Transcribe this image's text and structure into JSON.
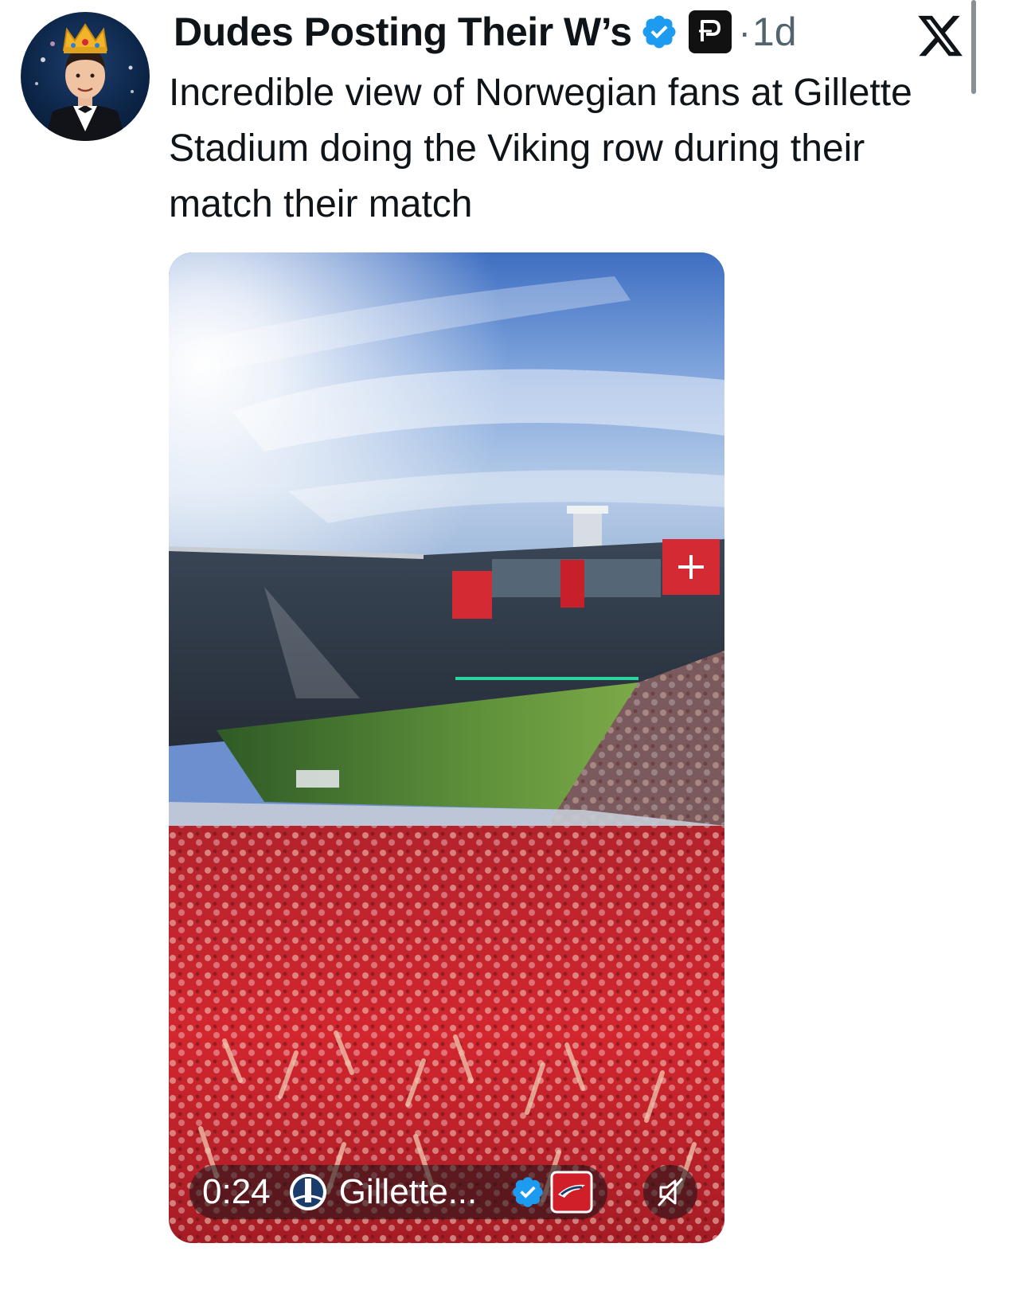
{
  "tweet": {
    "author": {
      "display_name": "Dudes Posting Their W’s",
      "verified": true,
      "affiliate_badge": "p-badge-icon",
      "avatar": "crowned-man-avatar"
    },
    "separator": "·",
    "timestamp": "1d",
    "text": "Incredible view of Norwegian fans at Gillette Stadium doing the Viking row during their match their match"
  },
  "media": {
    "type": "video",
    "elapsed": "0:24",
    "attribution": {
      "name": "Gillette...",
      "verified": true,
      "logo": "gillette-stadium-logo-icon",
      "team_badge": "patriots-logo-icon"
    },
    "mute_icon": "speaker-muted-icon"
  },
  "chrome": {
    "close_icon": "x-logo-icon"
  },
  "colors": {
    "text_primary": "#0f1419",
    "text_secondary": "#536471",
    "verified_blue": "#1d9bf0",
    "fan_red": "#d11f2a"
  }
}
